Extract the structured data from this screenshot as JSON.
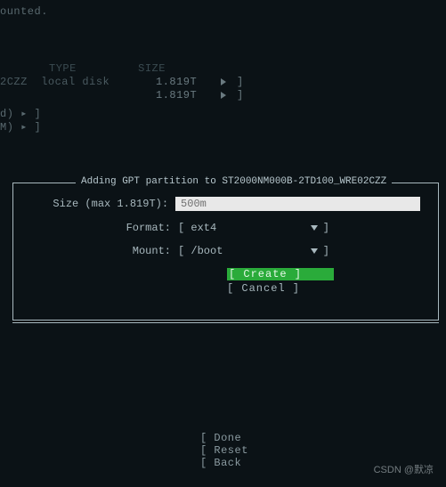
{
  "background": {
    "top_fragment": "ounted.",
    "col_header_left": "TYPE",
    "col_header_right": "SIZE",
    "disk_row_left": "2CZZ  local disk",
    "size1": "1.819T",
    "size2": "1.819T",
    "brk1": "▸ ]",
    "brk2": "▸ ]",
    "left_tag1": "d) ▸ ]",
    "left_tag2": "M) ▸ ]"
  },
  "dialog": {
    "title": "Adding GPT partition to ST2000NM000B-2TD100_WRE02CZZ",
    "size_label": "Size (max 1.819T):",
    "size_value": "500m",
    "format_label": "Format:",
    "format_value": "ext4",
    "mount_label": "Mount:",
    "mount_value": "/boot",
    "bracket_open": "[",
    "bracket_close": "]",
    "create_label": "[ Create    ]",
    "cancel_label": "[ Cancel    ]"
  },
  "footer": {
    "done": "[ Done",
    "reset": "[ Reset",
    "back": "[ Back"
  },
  "watermark": "CSDN @默凉"
}
